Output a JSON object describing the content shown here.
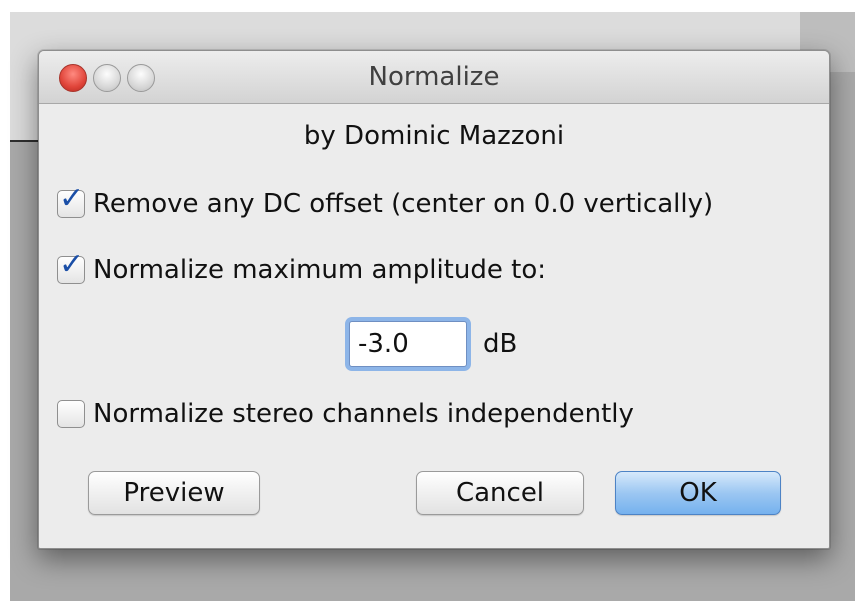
{
  "dialog": {
    "title": "Normalize",
    "byline": "by Dominic Mazzoni"
  },
  "options": {
    "remove_dc": {
      "label": "Remove any DC offset (center on 0.0 vertically)",
      "checked": true
    },
    "normalize_max": {
      "label": "Normalize maximum amplitude to:",
      "checked": true
    },
    "stereo_independent": {
      "label": "Normalize stereo channels independently",
      "checked": false
    }
  },
  "amplitude": {
    "value": "-3.0",
    "unit": "dB"
  },
  "buttons": {
    "preview": "Preview",
    "cancel": "Cancel",
    "ok": "OK"
  },
  "colors": {
    "accent": "#75b1ee",
    "focus_ring": "#8db5e8",
    "close_button": "#e0453a"
  }
}
